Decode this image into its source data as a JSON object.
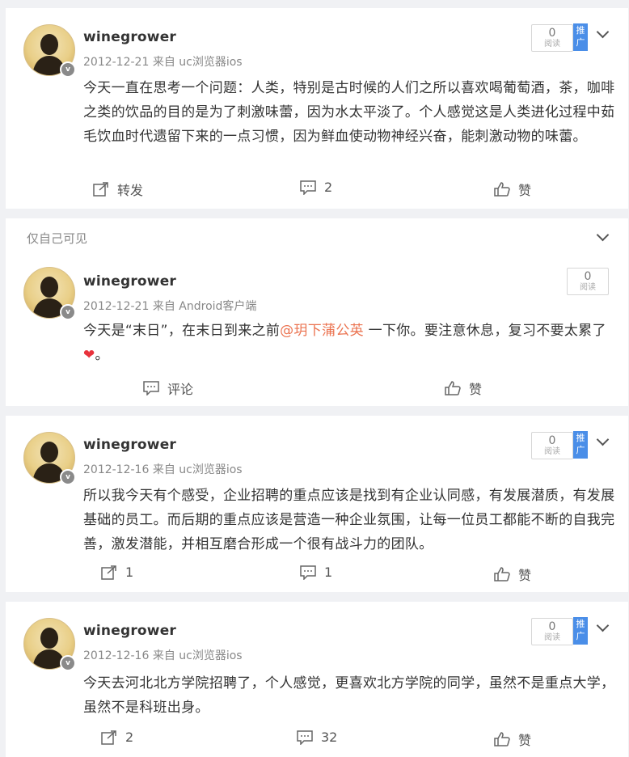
{
  "private_label": "仅自己可见",
  "read_label": "阅读",
  "promote_label": "推广",
  "colors": {
    "mention": "#eb7350",
    "promote": "#4a8ee8",
    "heart": "#e8323c"
  },
  "posts": [
    {
      "username": "winegrower",
      "date": "2012-12-21",
      "source": "来自 uc浏览器ios",
      "text": "今天一直在思考一个问题：人类，特别是古时候的人们之所以喜欢喝葡萄酒，茶，咖啡之类的饮品的目的是为了刺激味蕾，因为水太平淡了。个人感觉这是人类进化过程中茹毛饮血时代遗留下来的一点习惯，因为鲜血使动物神经兴奋，能刺激动物的味蕾。",
      "read_count": "0",
      "repost_label": "转发",
      "comment_count": "2",
      "like_label": "赞"
    },
    {
      "username": "winegrower",
      "date": "2012-12-21",
      "source": "来自 Android客户端",
      "text_before": "今天是“末日”，在末日到来之前",
      "mention": "@玥下蒲公英",
      "text_after": " 一下你。要注意休息，复习不要太累了",
      "text_end": "。",
      "read_count": "0",
      "comment_label": "评论",
      "like_label": "赞"
    },
    {
      "username": "winegrower",
      "date": "2012-12-16",
      "source": "来自 uc浏览器ios",
      "text": "所以我今天有个感受，企业招聘的重点应该是找到有企业认同感，有发展潜质，有发展基础的员工。而后期的重点应该是营造一种企业氛围，让每一位员工都能不断的自我完善，激发潜能，并相互磨合形成一个很有战斗力的团队。",
      "read_count": "0",
      "repost_count": "1",
      "comment_count": "1",
      "like_label": "赞"
    },
    {
      "username": "winegrower",
      "date": "2012-12-16",
      "source": "来自 uc浏览器ios",
      "text": "今天去河北北方学院招聘了，个人感觉，更喜欢北方学院的同学，虽然不是重点大学，虽然不是科班出身。",
      "read_count": "0",
      "repost_count": "2",
      "comment_count": "32",
      "like_label": "赞"
    }
  ]
}
